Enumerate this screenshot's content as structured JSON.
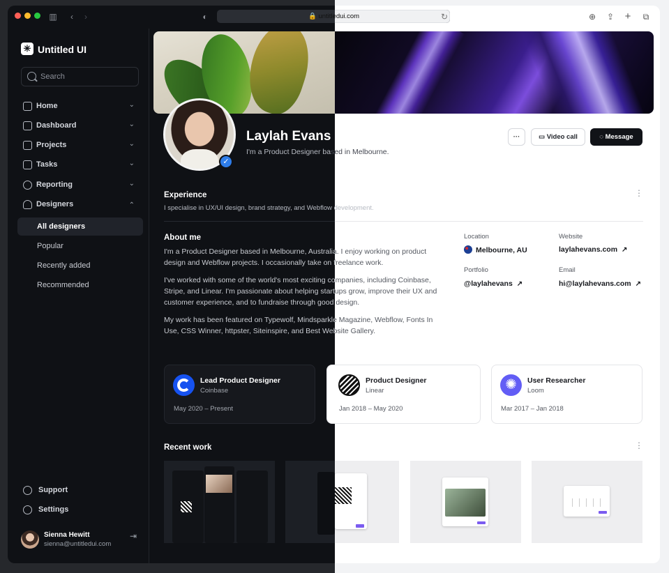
{
  "browser": {
    "url": "untitledui.com",
    "traffic_lights": [
      "#ff5f57",
      "#febc2e",
      "#28c840"
    ]
  },
  "sidebar": {
    "app_name": "Untitled UI",
    "search_placeholder": "Search",
    "nav": [
      {
        "label": "Home",
        "icon": "home-icon"
      },
      {
        "label": "Dashboard",
        "icon": "bar-chart-icon"
      },
      {
        "label": "Projects",
        "icon": "layers-icon"
      },
      {
        "label": "Tasks",
        "icon": "check-square-icon"
      },
      {
        "label": "Reporting",
        "icon": "pie-chart-icon"
      },
      {
        "label": "Designers",
        "icon": "users-icon"
      }
    ],
    "sub_nav": [
      {
        "label": "All designers",
        "active": true
      },
      {
        "label": "Popular"
      },
      {
        "label": "Recently added"
      },
      {
        "label": "Recommended"
      }
    ],
    "footer": [
      {
        "label": "Support",
        "icon": "life-buoy-icon"
      },
      {
        "label": "Settings",
        "icon": "gear-icon"
      }
    ],
    "user": {
      "name": "Sienna Hewitt",
      "email": "sienna@untitledui.com"
    }
  },
  "profile": {
    "name": "Laylah Evans",
    "bio_a": "I'm a Product Designer ba",
    "bio_b": "sed in Melbourne.",
    "actions": {
      "more": "···",
      "video": "Video call",
      "message": "Message"
    }
  },
  "experience": {
    "title": "Experience",
    "text": "I specialise in UX/UI design, brand strategy, and Webflow development."
  },
  "about": {
    "title": "About me",
    "paragraphs": [
      "I'm a Product Designer based in Melbourne, Australia. I enjoy working on product design and Webflow projects. I occasionally take on freelance work.",
      "I've worked with some of the world's most exciting companies, including Coinbase, Stripe, and Linear. I'm passionate about helping startups grow, improve their UX and customer experience, and to fundraise through good design.",
      "My work has been featured on Typewolf, Mindsparkle Magazine, Webflow, Fonts In Use, CSS Winner, httpster, Siteinspire, and Best Website Gallery."
    ]
  },
  "details": {
    "location_label": "Location",
    "location": "Melbourne, AU",
    "website_label": "Website",
    "website": "laylahevans.com",
    "portfolio_label": "Portfolio",
    "portfolio": "@laylahevans",
    "email_label": "Email",
    "email": "hi@laylahevans.com"
  },
  "jobs": [
    {
      "title": "Lead Product Designer",
      "company": "Coinbase",
      "dates": "May 2020 – Present",
      "logo": "coinbase-logo",
      "color": "#1652f0"
    },
    {
      "title": "Product Designer",
      "company": "Linear",
      "dates": "Jan 2018 – May 2020",
      "logo": "linear-logo",
      "color": "#111111"
    },
    {
      "title": "User Researcher",
      "company": "Loom",
      "dates": "Mar 2017 – Jan 2018",
      "logo": "loom-logo",
      "color": "#625df5"
    }
  ],
  "recent_work": {
    "title": "Recent work"
  }
}
